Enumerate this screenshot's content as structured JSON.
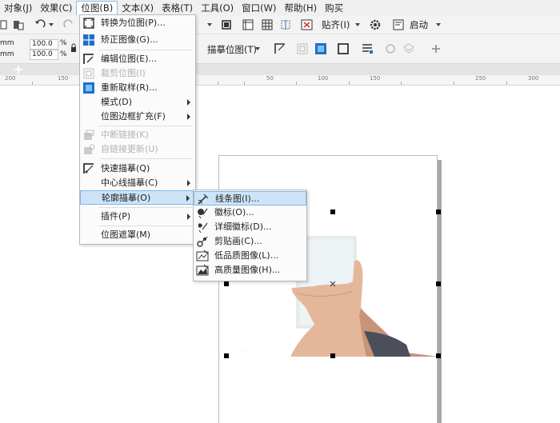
{
  "menubar": {
    "items": [
      {
        "label": "对象(J)",
        "active": false
      },
      {
        "label": "效果(C)",
        "active": false
      },
      {
        "label": "位图(B)",
        "active": true
      },
      {
        "label": "文本(X)",
        "active": false
      },
      {
        "label": "表格(T)",
        "active": false
      },
      {
        "label": "工具(O)",
        "active": false
      },
      {
        "label": "窗口(W)",
        "active": false
      },
      {
        "label": "帮助(H)",
        "active": false
      },
      {
        "label": "购买",
        "active": false
      }
    ]
  },
  "toolbar": {
    "paste_label": "贴齐(I)",
    "launch_label": "启动",
    "trace_bitmap_label": "描摹位图(T)"
  },
  "property_bar": {
    "width_unit": "mm",
    "height_unit": "mm",
    "scale_x": "100.0",
    "scale_y": "100.0",
    "percent": "%"
  },
  "ruler": {
    "labels": [
      "200",
      "150",
      "50",
      "100",
      "150",
      "250",
      "300"
    ]
  },
  "bitmap_menu": {
    "items": [
      {
        "label": "转换为位图(P)...",
        "icon": "convert-bitmap-icon",
        "disabled": false,
        "submenu": false
      },
      {
        "label": "矫正图像(G)...",
        "icon": "straighten-image-icon",
        "disabled": false,
        "submenu": false
      },
      {
        "label": "编辑位图(E)...",
        "icon": "edit-bitmap-icon",
        "disabled": false,
        "submenu": false
      },
      {
        "label": "裁剪位图(I)",
        "icon": "crop-bitmap-icon",
        "disabled": true,
        "submenu": false
      },
      {
        "label": "重新取样(R)...",
        "icon": "resample-icon",
        "disabled": false,
        "submenu": false
      },
      {
        "label": "模式(D)",
        "icon": "",
        "disabled": false,
        "submenu": true
      },
      {
        "label": "位图边框扩充(F)",
        "icon": "",
        "disabled": false,
        "submenu": true
      },
      {
        "label": "中断链接(K)",
        "icon": "break-link-icon",
        "disabled": true,
        "submenu": false
      },
      {
        "label": "自链接更新(U)",
        "icon": "update-link-icon",
        "disabled": true,
        "submenu": false
      },
      {
        "label": "快速描摹(Q)",
        "icon": "quick-trace-icon",
        "disabled": false,
        "submenu": false
      },
      {
        "label": "中心线描摹(C)",
        "icon": "",
        "disabled": false,
        "submenu": true
      },
      {
        "label": "轮廓描摹(O)",
        "icon": "",
        "disabled": false,
        "submenu": true,
        "highlighted": true
      },
      {
        "label": "插件(P)",
        "icon": "",
        "disabled": false,
        "submenu": true
      },
      {
        "label": "位图遮罩(M)",
        "icon": "",
        "disabled": false,
        "submenu": false
      }
    ]
  },
  "outline_trace_submenu": {
    "items": [
      {
        "label": "线条图(I)...",
        "icon": "line-art-icon",
        "highlighted": true
      },
      {
        "label": "徽标(O)...",
        "icon": "logo-icon",
        "highlighted": false
      },
      {
        "label": "详细徽标(D)...",
        "icon": "detailed-logo-icon",
        "highlighted": false
      },
      {
        "label": "剪贴画(C)...",
        "icon": "clipart-icon",
        "highlighted": false
      },
      {
        "label": "低品质图像(L)...",
        "icon": "low-quality-image-icon",
        "highlighted": false
      },
      {
        "label": "高质量图像(H)...",
        "icon": "high-quality-image-icon",
        "highlighted": false
      }
    ]
  },
  "colors": {
    "menu_highlight": "#cde4f8",
    "menu_highlight_border": "#7eb4ea",
    "icon_blue": "#1f6fc9"
  }
}
